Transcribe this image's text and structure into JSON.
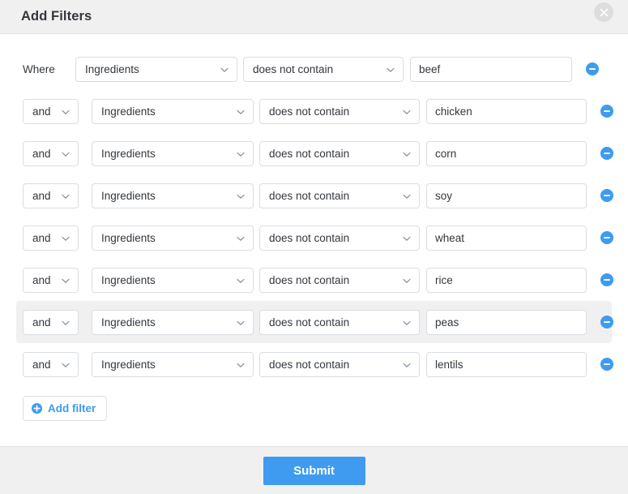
{
  "header": {
    "title": "Add Filters",
    "close_icon": "close-icon"
  },
  "body": {
    "where_label": "Where",
    "rows": [
      {
        "conjunction": "",
        "field": "Ingredients",
        "operator": "does not contain",
        "value": "beef",
        "hovered": false
      },
      {
        "conjunction": "and",
        "field": "Ingredients",
        "operator": "does not contain",
        "value": "chicken",
        "hovered": false
      },
      {
        "conjunction": "and",
        "field": "Ingredients",
        "operator": "does not contain",
        "value": "corn",
        "hovered": false
      },
      {
        "conjunction": "and",
        "field": "Ingredients",
        "operator": "does not contain",
        "value": "soy",
        "hovered": false
      },
      {
        "conjunction": "and",
        "field": "Ingredients",
        "operator": "does not contain",
        "value": "wheat",
        "hovered": false
      },
      {
        "conjunction": "and",
        "field": "Ingredients",
        "operator": "does not contain",
        "value": "rice",
        "hovered": false
      },
      {
        "conjunction": "and",
        "field": "Ingredients",
        "operator": "does not contain",
        "value": "peas",
        "hovered": true
      },
      {
        "conjunction": "and",
        "field": "Ingredients",
        "operator": "does not contain",
        "value": "lentils",
        "hovered": false
      }
    ],
    "remove_icon": "minus-circle-icon",
    "chevron_icon": "chevron-down-icon",
    "add_filter": {
      "label": "Add filter",
      "icon": "plus-circle-icon"
    }
  },
  "footer": {
    "submit_label": "Submit"
  },
  "colors": {
    "accent": "#3e9bf0",
    "header_bg": "#f0f0f0",
    "row_hover_bg": "#f0f0f0",
    "border": "#d9dde2",
    "text": "#33373d",
    "close_bg": "#dddddd"
  }
}
